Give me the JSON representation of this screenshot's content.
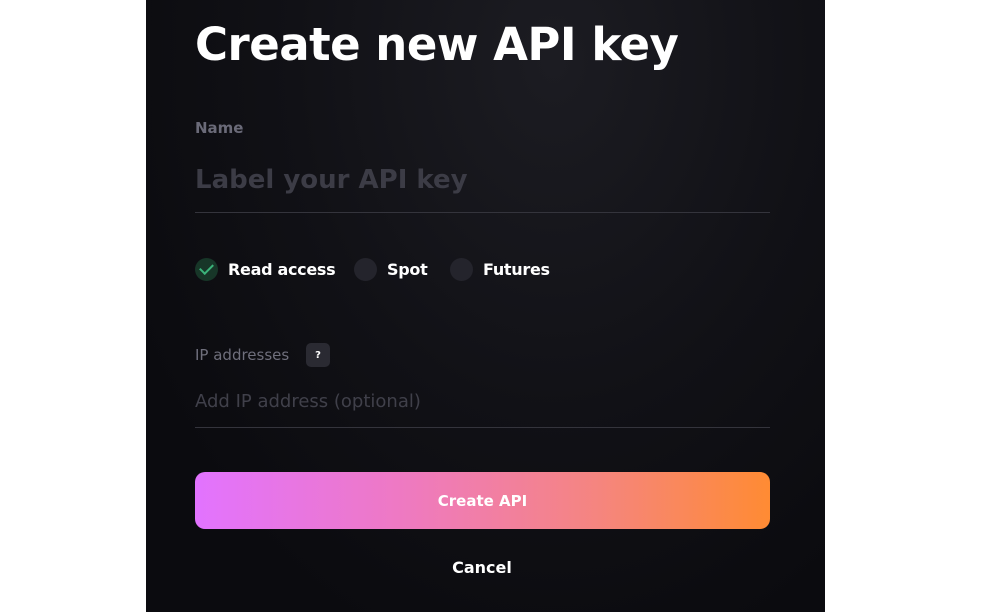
{
  "modal": {
    "title": "Create new API key"
  },
  "name_field": {
    "label": "Name",
    "value": "",
    "placeholder": "Label your API key"
  },
  "permissions": [
    {
      "label": "Read access",
      "checked": true,
      "icon": "check-icon"
    },
    {
      "label": "Spot",
      "checked": false
    },
    {
      "label": "Futures",
      "checked": false
    }
  ],
  "ip_field": {
    "label": "IP addresses",
    "help": "?",
    "value": "",
    "placeholder": "Add IP address (optional)"
  },
  "actions": {
    "create_label": "Create API",
    "cancel_label": "Cancel"
  },
  "colors": {
    "background": "#0b0b0f",
    "accent_gradient_start": "#e273ff",
    "accent_gradient_end": "#ff8b33",
    "check_green": "#3bb37a"
  }
}
